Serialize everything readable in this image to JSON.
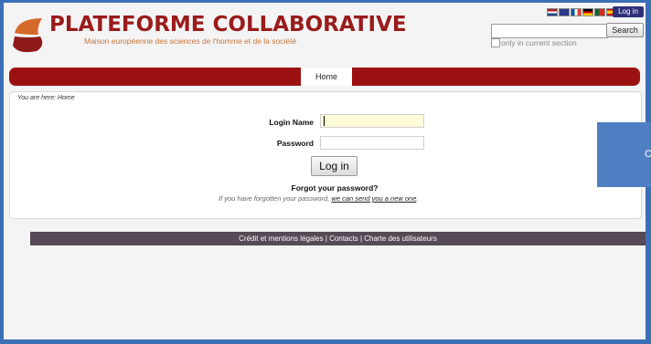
{
  "brand": {
    "title": "PLATEFORME COLLABORATIVE",
    "subtitle": "Maison européenne des sciences de l'homme et de la société"
  },
  "header": {
    "login_label": "Log in",
    "languages": [
      "nl-flag",
      "en-flag",
      "fr-flag",
      "de-flag",
      "pt-flag",
      "es-flag"
    ],
    "search": {
      "value": "",
      "button_label": "Search",
      "current_section_label": "only in current section",
      "current_section_checked": false
    }
  },
  "nav": {
    "home_label": "Home"
  },
  "breadcrumb": {
    "text": "You are here: Home"
  },
  "form": {
    "login_label": "Login Name",
    "login_value": "",
    "password_label": "Password",
    "password_value": "",
    "submit_label": "Log in"
  },
  "forgot": {
    "title": "Forgot your password?",
    "note_prefix": "If you have forgotten your password, ",
    "link_text": "we can send you a new one",
    "note_suffix": "."
  },
  "footer": {
    "text": "Crédit et mentions légales | Contacts | Charte des utilisateurs"
  },
  "overlay": {
    "glyph": "C"
  },
  "colors": {
    "brand_red": "#9b1111",
    "footer": "#554a55",
    "frame_blue": "#3b6fb6"
  }
}
